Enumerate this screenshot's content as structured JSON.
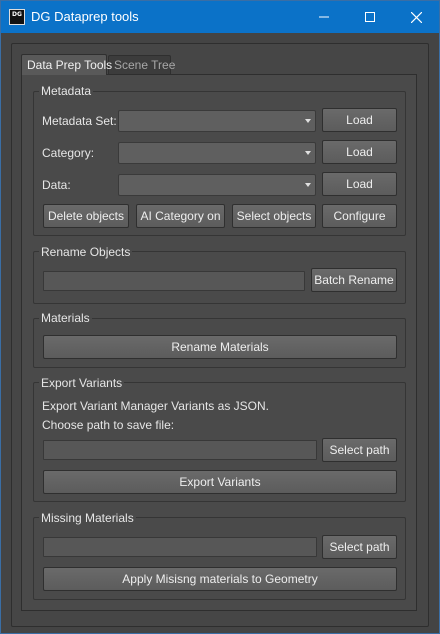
{
  "window": {
    "title": "DG Dataprep tools",
    "icon_text": "DG"
  },
  "tabs": [
    {
      "label": "Data Prep Tools",
      "active": true
    },
    {
      "label": "Scene Tree",
      "active": false
    }
  ],
  "metadata": {
    "group_title": "Metadata",
    "metadata_set_label": "Metadata Set:",
    "category_label": "Category:",
    "data_label": "Data:",
    "metadata_set_value": "",
    "category_value": "",
    "data_value": "",
    "load_label": "Load",
    "delete_objects_label": "Delete objects",
    "ai_category_on_label": "AI Category on",
    "select_objects_label": "Select objects",
    "configure_label": "Configure"
  },
  "rename_objects": {
    "group_title": "Rename Objects",
    "input_value": "",
    "batch_rename_label": "Batch Rename"
  },
  "materials": {
    "group_title": "Materials",
    "rename_materials_label": "Rename Materials"
  },
  "export_variants": {
    "group_title": "Export Variants",
    "description": "Export Variant Manager Variants as JSON.",
    "path_prompt": "Choose path to save file:",
    "path_value": "",
    "select_path_label": "Select path",
    "export_label": "Export Variants"
  },
  "missing_materials": {
    "group_title": "Missing Materials",
    "path_value": "",
    "select_path_label": "Select path",
    "apply_label": "Apply Misisng materials to Geometry"
  },
  "colors": {
    "titlebar": "#0b72c8",
    "background": "#444444",
    "button": "#616161"
  }
}
